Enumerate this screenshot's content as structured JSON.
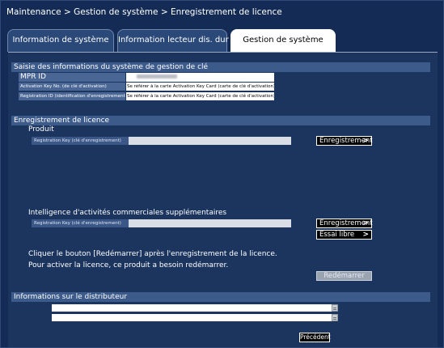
{
  "breadcrumb": "Maintenance > Gestion de système > Enregistrement de licence",
  "tabs": [
    {
      "label": "Information de système",
      "active": false
    },
    {
      "label": "Information lecteur dis. dur",
      "active": false
    },
    {
      "label": "Gestion de système",
      "active": true
    }
  ],
  "key_info": {
    "section_title": "Saisie des informations du système de gestion de clé",
    "mpr_label": "MPR ID",
    "activation_label": "Activation Key No. (de clé d'activation)",
    "activation_value": "Se référer à la carte Activation Key Card (carte de clé d'activation).",
    "registration_id_label": "Registration ID (identification d'enregistrement)",
    "registration_id_value": "Se référer à la carte Activation Key Card (carte de clé d'activation)."
  },
  "license": {
    "section_title": "Enregistrement de licence",
    "product_label": "Produit",
    "product_reg_label": "Registration Key (clé d'enregistrement)",
    "register_button": "Enregistrement",
    "bi_label": "Intelligence d'activités commerciales supplémentaires",
    "bi_reg_label": "Registration Key (clé d'enregistrement)",
    "bi_register_button": "Enregistrement",
    "trial_button": "Essai libre",
    "note_line1": "Cliquer le bouton [Redémarrer] après l'enregistrement de la licence.",
    "note_line2": "Pour activer la licence, ce produit a besoin redémarrer.",
    "restart_button": "Redémarrer"
  },
  "distributor": {
    "section_title": "Informations sur le distributeur"
  },
  "footer": {
    "back_button": "Précédent"
  },
  "colors": {
    "background": "#142c55",
    "section_bar": "#3c5b8b",
    "active_tab": "#ffffff"
  }
}
